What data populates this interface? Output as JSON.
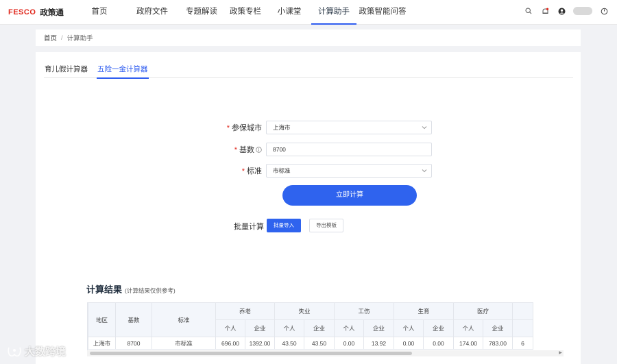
{
  "header": {
    "logo": "FESCO",
    "site_name": "政策通",
    "nav": [
      {
        "label": "首页"
      },
      {
        "label": "政府文件"
      },
      {
        "label": "专题解读"
      },
      {
        "label": "政策专栏"
      },
      {
        "label": "小课堂"
      },
      {
        "label": "计算助手",
        "active": true
      },
      {
        "label": "政策智能问答"
      }
    ],
    "icons": [
      "search-icon",
      "bell-icon",
      "user-icon",
      "power-icon"
    ]
  },
  "breadcrumb": {
    "home": "首页",
    "separator": "/",
    "current": "计算助手"
  },
  "tabs": [
    {
      "label": "育儿假计算器"
    },
    {
      "label": "五险一金计算器",
      "active": true
    }
  ],
  "form": {
    "city": {
      "label": "参保城市",
      "value": "上海市"
    },
    "base": {
      "label": "基数",
      "value": "8700"
    },
    "standard": {
      "label": "标准",
      "value": "市标准"
    },
    "calculate_label": "立即计算",
    "batch": {
      "label": "批量计算",
      "import_label": "批量导入",
      "export_label": "导出模板"
    }
  },
  "result": {
    "title": "计算结果",
    "note": "(计算结果仅供参考)",
    "head_fixed": [
      "地区",
      "基数",
      "标准"
    ],
    "groups": [
      "养老",
      "失业",
      "工伤",
      "生育",
      "医疗"
    ],
    "sub": {
      "personal": "个人",
      "company": "企业"
    },
    "rows": [
      {
        "region": "上海市",
        "base": "8700",
        "standard": "市标准",
        "values": [
          "696.00",
          "1392.00",
          "43.50",
          "43.50",
          "0.00",
          "13.92",
          "0.00",
          "0.00",
          "174.00",
          "783.00"
        ],
        "overflow": "6"
      }
    ]
  },
  "watermark": "大数跨境",
  "colors": {
    "accent": "#2f63ee",
    "brand_red": "#e0261b",
    "required": "#e0261b"
  }
}
